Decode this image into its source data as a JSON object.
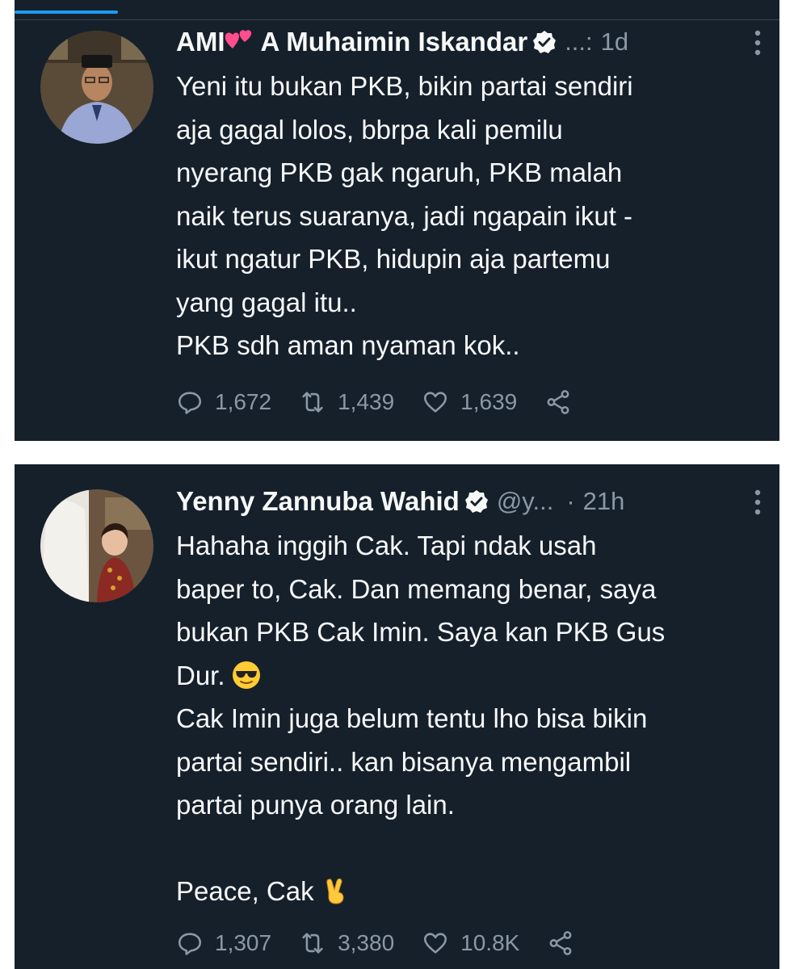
{
  "tweets": [
    {
      "display_name": "AMI",
      "display_name_suffix": "A Muhaimin Iskandar",
      "handle": "...:",
      "time": "1d",
      "body": "Yeni itu bukan PKB, bikin partai sendiri\naja gagal lolos, bbrpa kali pemilu\nnyerang PKB gak ngaruh, PKB malah\nnaik terus suaranya, jadi ngapain ikut -\nikut ngatur PKB, hidupin aja partemu\nyang gagal itu..\nPKB sdh aman nyaman kok..",
      "replies": "1,672",
      "retweets": "1,439",
      "likes": "1,639"
    },
    {
      "display_name": "Yenny Zannuba Wahid",
      "handle": "@y...",
      "time": "21h",
      "body_part1": "Hahaha inggih Cak. Tapi ndak usah\nbaper to, Cak. Dan memang benar, saya\nbukan PKB Cak Imin. Saya kan PKB Gus\nDur.",
      "body_part2": "Cak Imin juga belum tentu lho bisa bikin\npartai sendiri.. kan bisanya mengambil\npartai punya orang lain.\n\nPeace, Cak",
      "replies": "1,307",
      "retweets": "3,380",
      "likes": "10.8K"
    }
  ],
  "icons": [
    "verified-badge-icon",
    "more-icon",
    "reply-icon",
    "retweet-icon",
    "like-icon",
    "share-icon",
    "heart-emoji-icon",
    "sunglasses-emoji-icon",
    "victory-hand-emoji-icon"
  ],
  "colors": {
    "background": "#15202b",
    "text": "#f7f9f9",
    "muted": "#8b98a5",
    "accent": "#1d9bf0"
  }
}
